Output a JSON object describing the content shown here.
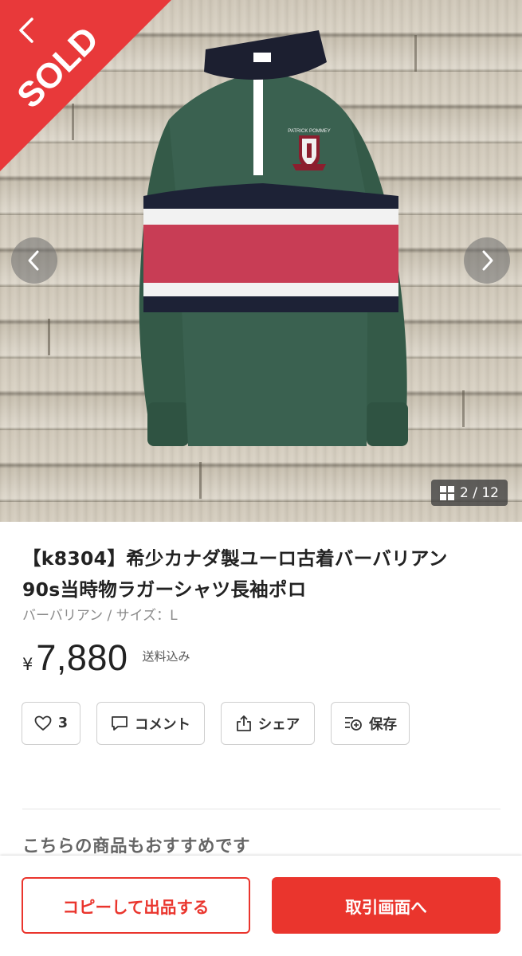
{
  "gallery": {
    "sold_label": "SOLD",
    "counter": "2 / 12",
    "brand_embroidery": "PATRICK POMMEY"
  },
  "product": {
    "title_line1": "【k8304】希少カナダ製ユーロ古着バーバリアン",
    "title_line2": "90s当時物ラガーシャツ長袖ポロ",
    "subtitle": "バーバリアン / サイズ：L",
    "currency": "¥",
    "price": "7,880",
    "shipping": "送料込み"
  },
  "actions": {
    "like_count": "3",
    "comment": "コメント",
    "share": "シェア",
    "save": "保存"
  },
  "recommend": {
    "heading": "こちらの商品もおすすめです"
  },
  "bottom": {
    "copy_button": "コピーして出品する",
    "trade_button": "取引画面へ"
  },
  "colors": {
    "accent": "#ea352d",
    "sold_ribbon": "#e8393a"
  }
}
